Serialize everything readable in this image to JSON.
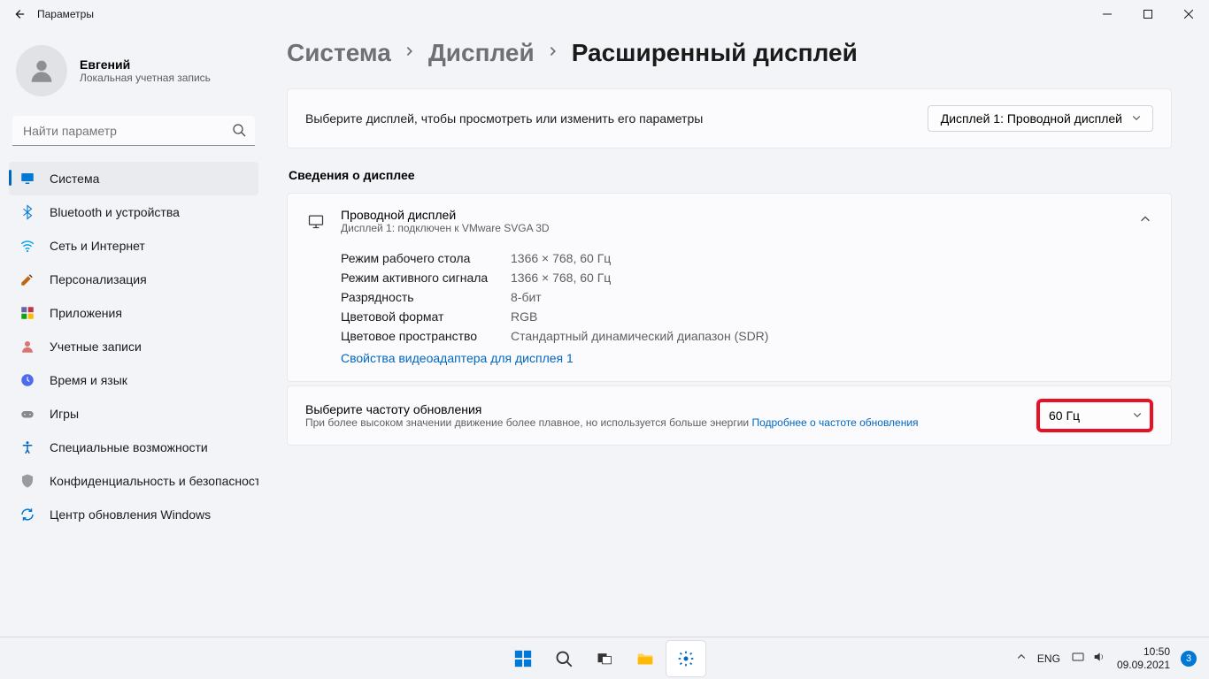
{
  "titlebar": {
    "title": "Параметры"
  },
  "user": {
    "name": "Евгений",
    "sub": "Локальная учетная запись"
  },
  "search": {
    "placeholder": "Найти параметр"
  },
  "nav": [
    {
      "label": "Система",
      "active": true,
      "icon": "system"
    },
    {
      "label": "Bluetooth и устройства",
      "active": false,
      "icon": "bluetooth"
    },
    {
      "label": "Сеть и Интернет",
      "active": false,
      "icon": "network"
    },
    {
      "label": "Персонализация",
      "active": false,
      "icon": "personalization"
    },
    {
      "label": "Приложения",
      "active": false,
      "icon": "apps"
    },
    {
      "label": "Учетные записи",
      "active": false,
      "icon": "accounts"
    },
    {
      "label": "Время и язык",
      "active": false,
      "icon": "time"
    },
    {
      "label": "Игры",
      "active": false,
      "icon": "gaming"
    },
    {
      "label": "Специальные возможности",
      "active": false,
      "icon": "accessibility"
    },
    {
      "label": "Конфиденциальность и безопасность",
      "active": false,
      "icon": "privacy"
    },
    {
      "label": "Центр обновления Windows",
      "active": false,
      "icon": "update"
    }
  ],
  "breadcrumb": {
    "a": "Система",
    "b": "Дисплей",
    "c": "Расширенный дисплей"
  },
  "select_display": {
    "text": "Выберите дисплей, чтобы просмотреть или изменить его параметры",
    "value": "Дисплей 1: Проводной дисплей"
  },
  "section_heading": "Сведения о дисплее",
  "expander": {
    "title": "Проводной дисплей",
    "sub": "Дисплей 1: подключен к VMware SVGA 3D"
  },
  "info": [
    {
      "k": "Режим рабочего стола",
      "v": "1366 × 768, 60 Гц"
    },
    {
      "k": "Режим активного сигнала",
      "v": "1366 × 768, 60 Гц"
    },
    {
      "k": "Разрядность",
      "v": "8-бит"
    },
    {
      "k": "Цветовой формат",
      "v": "RGB"
    },
    {
      "k": "Цветовое пространство",
      "v": "Стандартный динамический диапазон (SDR)"
    }
  ],
  "adapter_link": "Свойства видеоадаптера для дисплея 1",
  "refresh": {
    "title": "Выберите частоту обновления",
    "sub": "При более высоком значении движение более плавное, но используется больше энергии  ",
    "more": "Подробнее о частоте обновления",
    "value": "60 Гц"
  },
  "taskbar": {
    "lang": "ENG",
    "time": "10:50",
    "date": "09.09.2021",
    "badge": "3"
  }
}
